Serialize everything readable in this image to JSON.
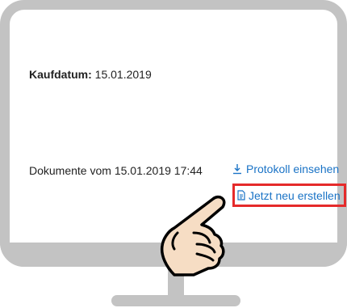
{
  "purchase": {
    "label": "Kaufdatum:",
    "value": "15.01.2019"
  },
  "documents": {
    "text": "Dokumente vom 15.01.2019 17:44"
  },
  "actions": {
    "view_protocol_label": "Protokoll einsehen",
    "view_protocol_icon": "download-icon",
    "recreate_label": "Jetzt neu erstellen",
    "recreate_icon": "document-icon"
  },
  "colors": {
    "link": "#1a73c6",
    "highlight": "#e52a2a",
    "monitor": "#c3c3c3"
  }
}
